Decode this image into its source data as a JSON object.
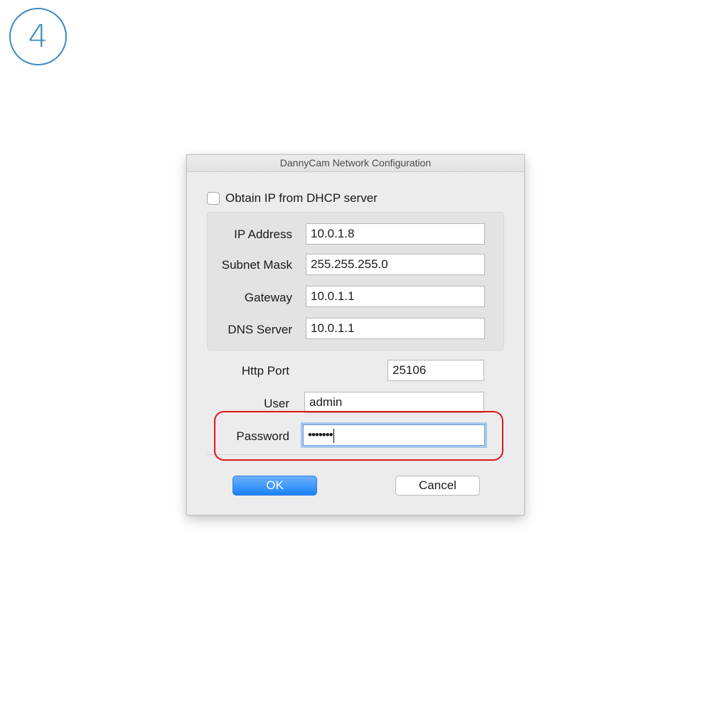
{
  "step_badge": "4",
  "dialog": {
    "title": "DannyCam Network Configuration",
    "dhcp_checkbox": {
      "label": "Obtain IP from DHCP server",
      "checked": false
    },
    "ip_address": {
      "label": "IP Address",
      "value": "10.0.1.8"
    },
    "subnet_mask": {
      "label": "Subnet Mask",
      "value": "255.255.255.0"
    },
    "gateway": {
      "label": "Gateway",
      "value": "10.0.1.1"
    },
    "dns_server": {
      "label": "DNS Server",
      "value": "10.0.1.1"
    },
    "http_port": {
      "label": "Http Port",
      "value": "25106"
    },
    "user": {
      "label": "User",
      "value": "admin"
    },
    "password": {
      "label": "Password",
      "masked_value": "•••••••"
    },
    "ok_label": "OK",
    "cancel_label": "Cancel"
  },
  "colors": {
    "badge": "#3a88c3",
    "highlight": "#e0141e",
    "primary_button": "#1a82fb",
    "focus_ring": "#a6c8ee"
  }
}
